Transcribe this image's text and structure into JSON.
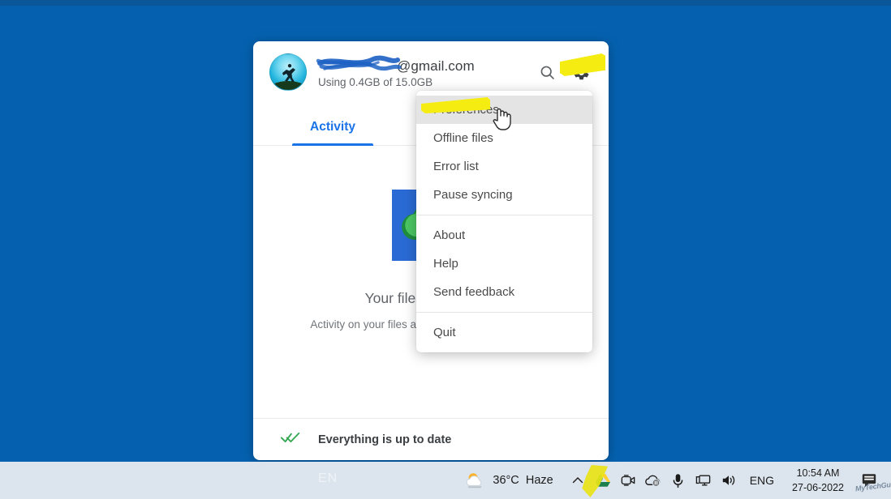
{
  "desktop": {
    "background_color": "#0561AF"
  },
  "drive_panel": {
    "account": {
      "email_redacted": true,
      "email_domain": "@gmail.com",
      "storage_line": "Using 0.4GB of 15.0GB",
      "avatar_name": "user-avatar"
    },
    "header_actions": {
      "search_label": "search-icon",
      "settings_label": "gear-icon"
    },
    "tabs": [
      {
        "label": "Activity",
        "active": true
      }
    ],
    "empty_state": {
      "illustration": "folder-cloud-check-icon",
      "title": "Your files a",
      "title_full": "Your files and folders",
      "subtitle": "Activity on your files and folders will show up here"
    },
    "footer": {
      "status_icon": "double-check-icon",
      "status_text": "Everything is up to date",
      "status_color": "#34a853"
    }
  },
  "context_menu": {
    "groups": [
      {
        "items": [
          {
            "label": "Preferences",
            "hovered": true,
            "highlighted": true
          },
          {
            "label": "Offline files",
            "hovered": false,
            "highlighted": false
          },
          {
            "label": "Error list",
            "hovered": false,
            "highlighted": false
          },
          {
            "label": "Pause syncing",
            "hovered": false,
            "highlighted": false
          }
        ]
      },
      {
        "items": [
          {
            "label": "About",
            "hovered": false,
            "highlighted": false
          },
          {
            "label": "Help",
            "hovered": false,
            "highlighted": false
          },
          {
            "label": "Send feedback",
            "hovered": false,
            "highlighted": false
          }
        ]
      },
      {
        "items": [
          {
            "label": "Quit",
            "hovered": false,
            "highlighted": false
          }
        ]
      }
    ]
  },
  "annotations": {
    "highlighter_color": "#f5ec12",
    "gear_highlight": "gear-icon highlighted",
    "preferences_highlight": "Preferences highlighted",
    "tray_highlight": "google-drive-tray-icon highlighted"
  },
  "taskbar": {
    "watermark_text": "EN",
    "weather": {
      "icon": "sun-behind-cloud-icon",
      "temperature": "36°C",
      "condition": "Haze"
    },
    "tray_icons": [
      {
        "name": "chevron-up-icon"
      },
      {
        "name": "google-drive-icon"
      },
      {
        "name": "webcam-icon"
      },
      {
        "name": "onedrive-paused-icon"
      },
      {
        "name": "microphone-icon"
      },
      {
        "name": "display-icon"
      },
      {
        "name": "volume-icon"
      }
    ],
    "language": "ENG",
    "clock": {
      "time": "10:54 AM",
      "date": "27-06-2022"
    },
    "notifications": {
      "icon": "notification-icon",
      "watermark": "MyTechGuide"
    }
  }
}
